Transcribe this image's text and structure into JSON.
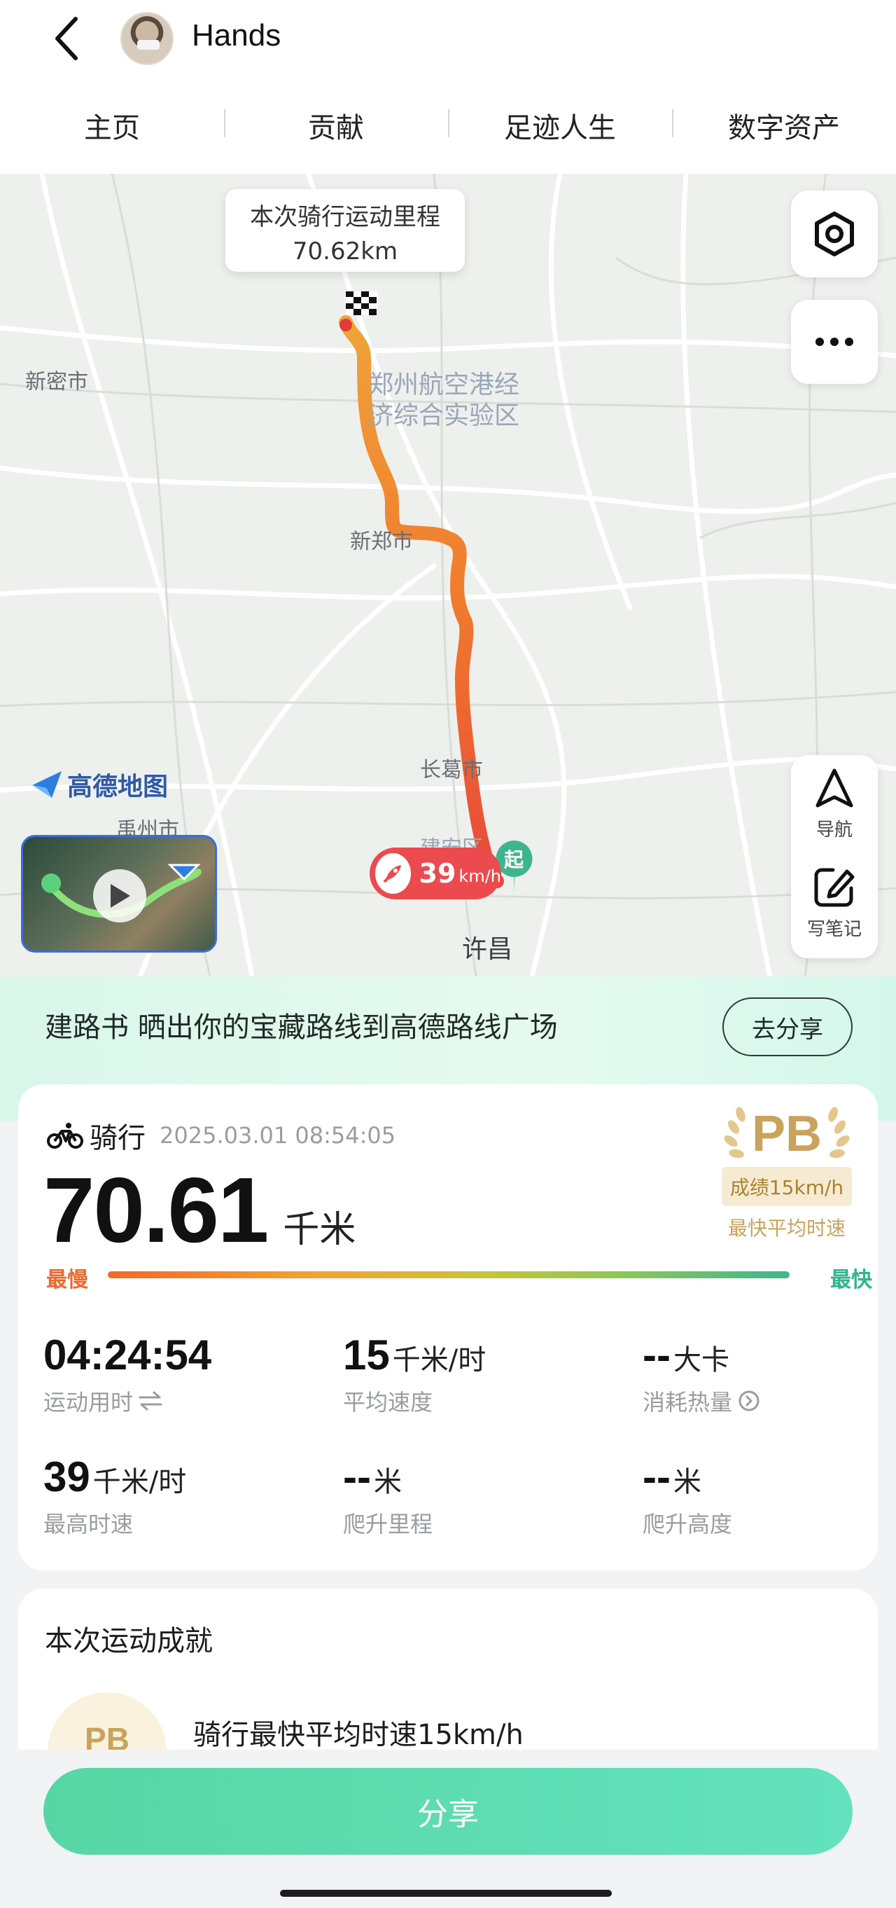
{
  "header": {
    "username": "Hands"
  },
  "tabs": [
    {
      "label": "主页"
    },
    {
      "label": "贡献"
    },
    {
      "label": "足迹人生"
    },
    {
      "label": "数字资产"
    }
  ],
  "map": {
    "tooltip_title": "本次骑行运动里程",
    "tooltip_value": "70.62km",
    "labels": {
      "xinmi": "新密市",
      "zone": "郑州航空港经济综合实验区",
      "zone_line1": "郑州航空港经",
      "zone_line2": "济综合实验区",
      "xinzheng": "新郑市",
      "changge": "长葛市",
      "yuzhou": "禹州市",
      "jianan": "建安区",
      "xuchang": "许昌"
    },
    "brand": "高德地图",
    "speed_value": "39",
    "speed_unit": "km/h",
    "start_marker": "起",
    "nav_label": "导航",
    "note_label": "写笔记",
    "route_colors": [
      "#f0a33a",
      "#f07a2c",
      "#e9483a"
    ]
  },
  "banner": {
    "text": "建路书 晒出你的宝藏路线到高德路线广场",
    "button": "去分享"
  },
  "activity": {
    "type": "骑行",
    "datetime": "2025.03.01 08:54:05",
    "distance": "70.61",
    "distance_unit": "千米",
    "pb_mark": "PB",
    "pb_badge": "成绩15km/h",
    "pb_sub": "最快平均时速",
    "bar_left": "最慢",
    "bar_right": "最快",
    "metrics": [
      {
        "value": "04:24:54",
        "unit": "",
        "label": "运动用时"
      },
      {
        "value": "15",
        "unit": "千米/时",
        "label": "平均速度"
      },
      {
        "value": "--",
        "unit": "大卡",
        "label": "消耗热量"
      },
      {
        "value": "39",
        "unit": "千米/时",
        "label": "最高时速"
      },
      {
        "value": "--",
        "unit": "米",
        "label": "爬升里程"
      },
      {
        "value": "--",
        "unit": "米",
        "label": "爬升高度"
      }
    ]
  },
  "achievements": {
    "title": "本次运动成就",
    "badge": "PB",
    "item": "骑行最快平均时速15km/h"
  },
  "share_button": "分享",
  "colors": {
    "accent": "#57d6a5",
    "gold": "#c9a35b",
    "route_red": "#ec4a4f"
  }
}
